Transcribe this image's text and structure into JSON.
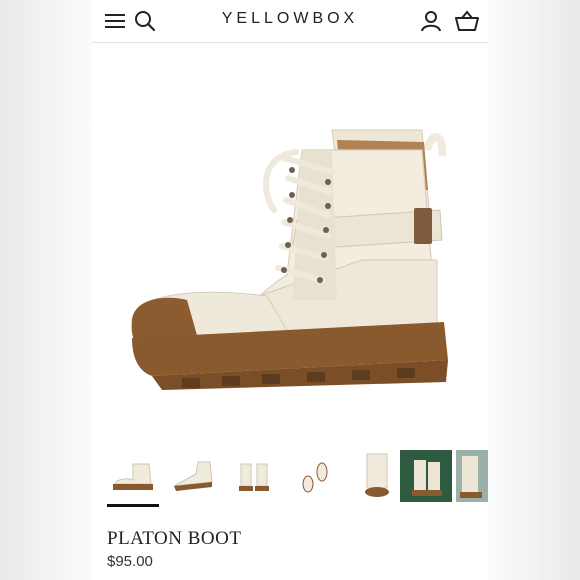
{
  "header": {
    "brand": "YELLOWBOX",
    "icons": [
      "menu-icon",
      "search-icon",
      "account-icon",
      "cart-icon"
    ]
  },
  "product": {
    "title": "PLATON BOOT",
    "price": "$95.00"
  },
  "thumbnails": [
    {
      "name": "side view",
      "active": true
    },
    {
      "name": "angle view",
      "active": false
    },
    {
      "name": "pair front",
      "active": false
    },
    {
      "name": "pair top",
      "active": false
    },
    {
      "name": "front view",
      "active": false
    },
    {
      "name": "lifestyle green",
      "active": false
    },
    {
      "name": "lifestyle outdoor",
      "active": false
    }
  ],
  "colors": {
    "canvas": "#f4efe2",
    "sole": "#8a5a2f",
    "lace": "#f1ece0",
    "accent": "#111111"
  }
}
